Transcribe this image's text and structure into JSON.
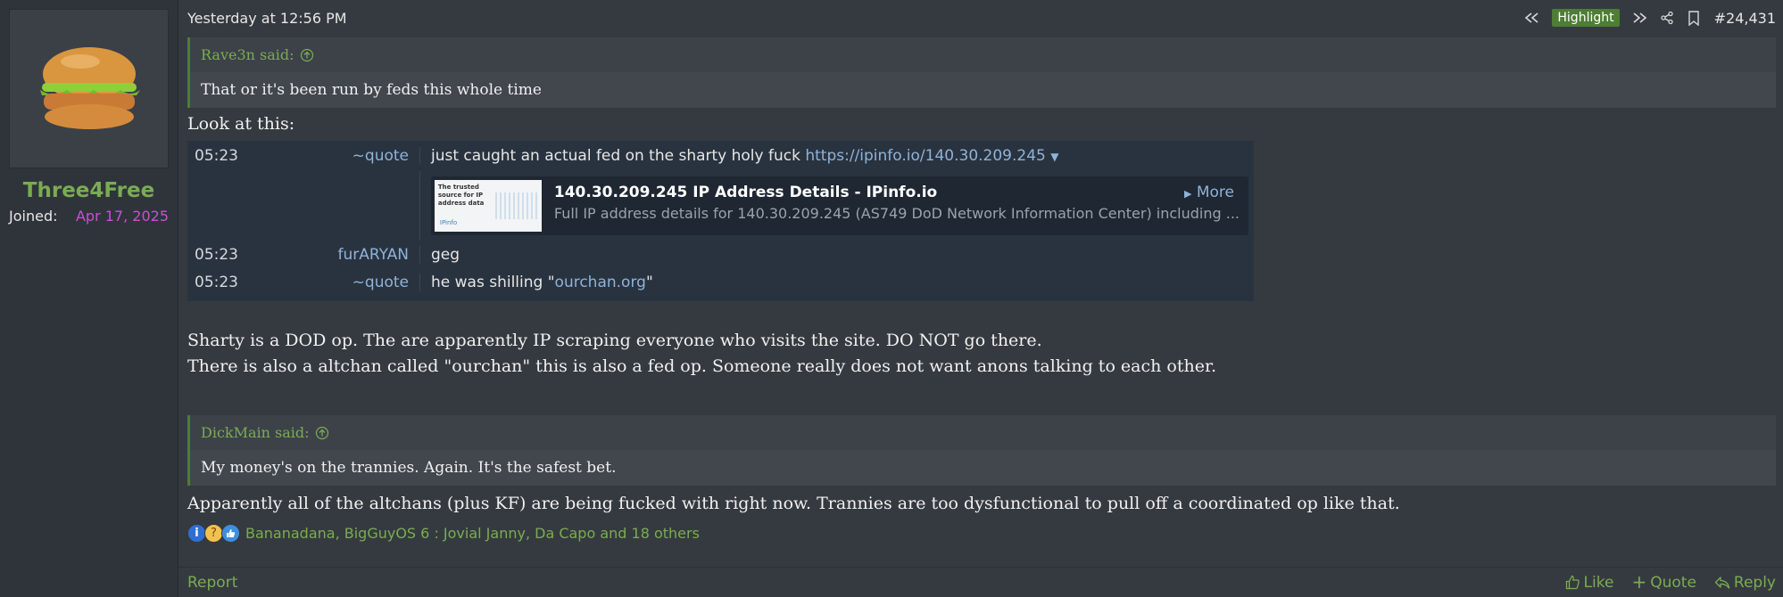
{
  "user": {
    "name": "Three4Free",
    "joined_label": "Joined:",
    "joined_date": "Apr 17, 2025"
  },
  "header": {
    "date": "Yesterday at 12:56 PM",
    "highlight": "Highlight",
    "post_number": "#24,431"
  },
  "quote1": {
    "author": "Rave3n said:",
    "text": "That or it's been run by feds this whole time"
  },
  "intro": "Look at this:",
  "chat": {
    "rows": [
      {
        "time": "05:23",
        "nick": "~quote",
        "msg": "just caught an actual fed on the sharty holy fuck ",
        "link": "https://ipinfo.io/140.30.209.245"
      },
      {
        "time": "05:23",
        "nick": "furARYAN",
        "msg": "geg"
      },
      {
        "time": "05:23",
        "nick": "~quote",
        "msg_before": "he was shilling \"",
        "link": "ourchan.org",
        "msg_after": "\""
      }
    ],
    "preview": {
      "thumb_text": "The trusted source for IP address data",
      "thumb_brand": "IPinfo",
      "title": "140.30.209.245 IP Address Details - IPinfo.io",
      "description": "Full IP address details for 140.30.209.245 (AS749 DoD Network Information Center) including ...",
      "more": "More"
    }
  },
  "paragraph1": "Sharty is a DOD op. The are apparently IP scraping everyone who visits the site. DO NOT go there.",
  "paragraph2": "There is also a altchan called \"ourchan\" this is also a fed op. Someone really does not want anons talking to each other.",
  "quote2": {
    "author": "DickMain said:",
    "text": "My money's on the trannies. Again. It's the safest bet."
  },
  "paragraph3": "Apparently all of the altchans (plus KF) are being fucked with right now. Trannies are too dysfunctional to pull off a coordinated op like that.",
  "reactions": {
    "text": "Bananadana, BigGuyOS 6 : Jovial Janny, Da Capo and 18 others"
  },
  "footer": {
    "report": "Report",
    "like": "Like",
    "quote": "Quote",
    "reply": "Reply"
  },
  "colors": {
    "accent_green": "#7aac52",
    "background": "#353a40",
    "joined_date": "#c94fd4"
  }
}
